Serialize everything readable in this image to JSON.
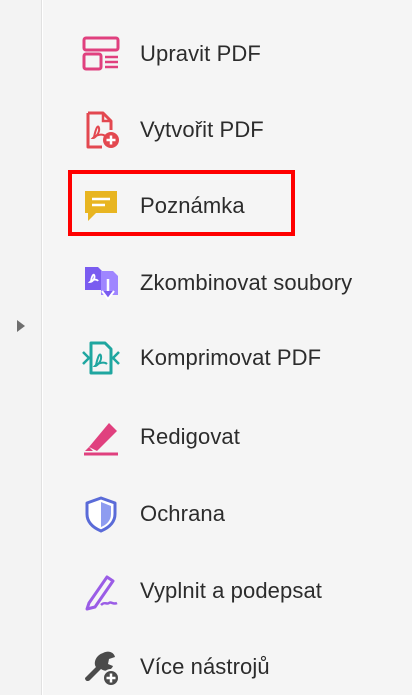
{
  "tools": [
    {
      "label": "Upravit PDF",
      "icon": "edit-pdf-icon",
      "color": "#e0407e"
    },
    {
      "label": "Vytvořit PDF",
      "icon": "create-pdf-icon",
      "color": "#e34850"
    },
    {
      "label": "Poznámka",
      "icon": "comment-icon",
      "color": "#e8b521"
    },
    {
      "label": "Zkombinovat soubory",
      "icon": "combine-files-icon",
      "color": "#7a5cf0"
    },
    {
      "label": "Komprimovat PDF",
      "icon": "compress-pdf-icon",
      "color": "#1fa6a0"
    },
    {
      "label": "Redigovat",
      "icon": "redact-icon",
      "color": "#e0407e"
    },
    {
      "label": "Ochrana",
      "icon": "protect-icon",
      "color": "#5a6bd8"
    },
    {
      "label": "Vyplnit a podepsat",
      "icon": "fill-sign-icon",
      "color": "#9a5ce6"
    },
    {
      "label": "Více nástrojů",
      "icon": "more-tools-icon",
      "color": "#4b4b4b"
    }
  ],
  "highlighted_tool": "Poznámka",
  "highlight_color": "#ff0000",
  "expand_icon": "chevron-right-icon"
}
